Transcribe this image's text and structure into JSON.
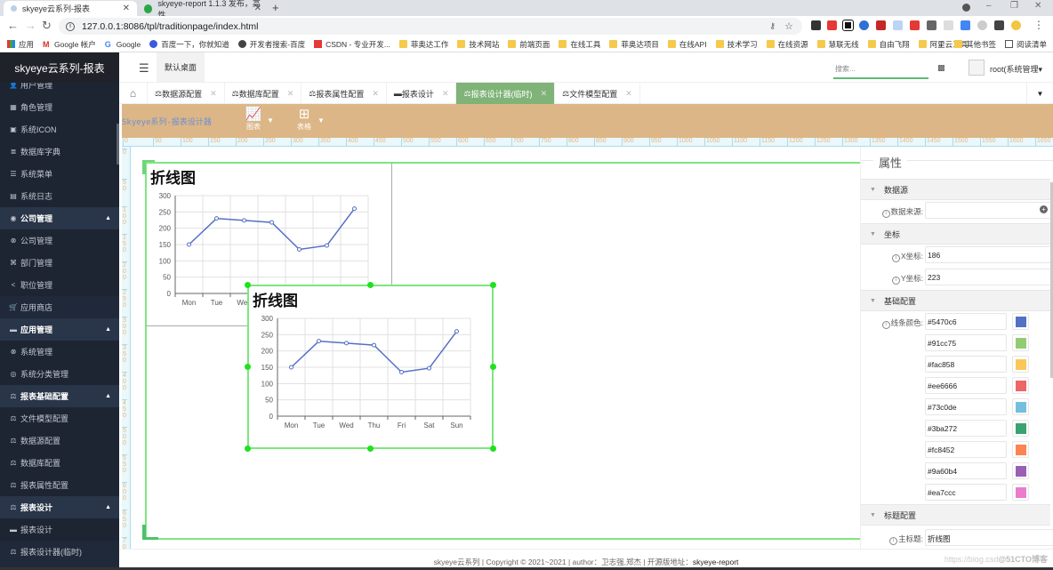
{
  "browser": {
    "tabs": [
      {
        "title": "skyeye云系列-报表",
        "active": true
      },
      {
        "title": "skyeye-report 1.1.3 发布，高性",
        "active": false
      }
    ],
    "url": "127.0.0.1:8086/tpl/traditionpage/index.html",
    "bookmarks": [
      "应用",
      "Google 帐户",
      "Google",
      "百度一下，你就知道",
      "开发者搜索-百度",
      "CSDN - 专业开发...",
      "菲奥达工作",
      "技术网站",
      "前端页面",
      "在线工具",
      "菲奥达项目",
      "在线API",
      "技术学习",
      "在线资源",
      "慧联无线",
      "自由飞翔",
      "阿里云工具"
    ],
    "other_bookmarks": "其他书签",
    "reading_list": "阅读清单"
  },
  "app": {
    "logo": "skyeye云系列-报表",
    "home_tab": "默认桌面",
    "search_placeholder": "搜索...",
    "user": "root(系统管理"
  },
  "sidebar": {
    "items": [
      {
        "label": "用户管理",
        "type": "sub",
        "icon": "user-icon"
      },
      {
        "label": "角色管理",
        "type": "sub",
        "icon": "grid-icon"
      },
      {
        "label": "系统ICON",
        "type": "sub",
        "icon": "image-icon"
      },
      {
        "label": "数据库字典",
        "type": "sub",
        "icon": "database-icon"
      },
      {
        "label": "系统菜单",
        "type": "sub",
        "icon": "list-icon"
      },
      {
        "label": "系统日志",
        "type": "sub",
        "icon": "log-icon"
      },
      {
        "label": "公司管理",
        "type": "group",
        "icon": "globe-icon"
      },
      {
        "label": "公司管理",
        "type": "sub",
        "icon": "link-icon"
      },
      {
        "label": "部门管理",
        "type": "sub",
        "icon": "dept-icon"
      },
      {
        "label": "职位管理",
        "type": "sub",
        "icon": "share-icon"
      },
      {
        "label": "应用商店",
        "type": "plain",
        "icon": "cart-icon"
      },
      {
        "label": "应用管理",
        "type": "group",
        "icon": "window-icon"
      },
      {
        "label": "系统管理",
        "type": "sub",
        "icon": "link-icon"
      },
      {
        "label": "系统分类管理",
        "type": "sub",
        "icon": "category-icon"
      },
      {
        "label": "报表基础配置",
        "type": "group",
        "icon": "scale-icon"
      },
      {
        "label": "文件模型配置",
        "type": "sub",
        "icon": "scale-icon"
      },
      {
        "label": "数据源配置",
        "type": "sub",
        "icon": "scale-icon"
      },
      {
        "label": "数据库配置",
        "type": "sub",
        "icon": "scale-icon"
      },
      {
        "label": "报表属性配置",
        "type": "sub",
        "icon": "scale-icon"
      },
      {
        "label": "报表设计",
        "type": "group",
        "icon": "scale-icon"
      },
      {
        "label": "报表设计",
        "type": "sub",
        "icon": "window-icon"
      },
      {
        "label": "报表设计器(临时)",
        "type": "plain",
        "icon": "scale-icon"
      }
    ]
  },
  "page_tabs": [
    {
      "label": "数据源配置",
      "active": false
    },
    {
      "label": "数据库配置",
      "active": false
    },
    {
      "label": "报表属性配置",
      "active": false
    },
    {
      "label": "报表设计",
      "active": false
    },
    {
      "label": "报表设计器(临时)",
      "active": true
    },
    {
      "label": "文件模型配置",
      "active": false
    }
  ],
  "designer": {
    "title": "Skyeye系列-报表设计器",
    "chart_button": "图表",
    "table_button": "表格",
    "ruler_h": [
      "0",
      "50",
      "100",
      "150",
      "200",
      "250",
      "300",
      "350",
      "400",
      "450",
      "500",
      "550",
      "600",
      "650",
      "700",
      "750",
      "800",
      "850",
      "900",
      "950",
      "1000",
      "1050",
      "1100",
      "1150",
      "1200",
      "1250",
      "1300",
      "1350",
      "1400",
      "1450",
      "1500",
      "1550",
      "1600",
      "1650"
    ],
    "ruler_v": [
      "0",
      "50",
      "100",
      "150",
      "200",
      "250",
      "300",
      "350",
      "400",
      "450",
      "500",
      "550",
      "600",
      "650",
      "700"
    ]
  },
  "chart_data": [
    {
      "type": "line",
      "title": "折线图",
      "categories": [
        "Mon",
        "Tue",
        "Wed",
        "Thu",
        "Fri",
        "Sat",
        "Sun"
      ],
      "series": [
        {
          "name": "",
          "values": [
            150,
            230,
            224,
            218,
            135,
            147,
            260
          ],
          "color": "#5470c6"
        }
      ],
      "yticks": [
        "0",
        "50",
        "100",
        "150",
        "200",
        "250",
        "300"
      ],
      "ylim": [
        0,
        300
      ],
      "grid": true,
      "xlabel": "",
      "ylabel": ""
    },
    {
      "type": "line",
      "title": "折线图",
      "categories": [
        "Mon",
        "Tue",
        "Wed",
        "Thu",
        "Fri",
        "Sat",
        "Sun"
      ],
      "series": [
        {
          "name": "",
          "values": [
            150,
            230,
            224,
            218,
            135,
            147,
            260
          ],
          "color": "#5470c6"
        }
      ],
      "yticks": [
        "0",
        "50",
        "100",
        "150",
        "200",
        "250",
        "300"
      ],
      "ylim": [
        0,
        300
      ],
      "grid": true,
      "xlabel": "",
      "ylabel": ""
    }
  ],
  "properties": {
    "title": "属性",
    "sections": {
      "datasource": "数据源",
      "coordinates": "坐标",
      "basic": "基础配置",
      "title_config": "标题配置"
    },
    "datasource_label": "数据来源:",
    "x_label": "X坐标:",
    "x_value": "186",
    "y_label": "Y坐标:",
    "y_value": "223",
    "line_color_label": "线条颜色:",
    "colors": [
      "#5470c6",
      "#91cc75",
      "#fac858",
      "#ee6666",
      "#73c0de",
      "#3ba272",
      "#fc8452",
      "#9a60b4",
      "#ea7ccc"
    ],
    "main_title_label": "主标题:",
    "main_title_value": "折线图"
  },
  "footer": {
    "text": "skyeye云系列 | Copyright © 2021~2021 | author：卫志强,郑杰 | 开源版地址：",
    "link": "skyeye-report"
  },
  "watermark": {
    "url": "https://blog.csd",
    "brand": "@51CTO博客"
  }
}
